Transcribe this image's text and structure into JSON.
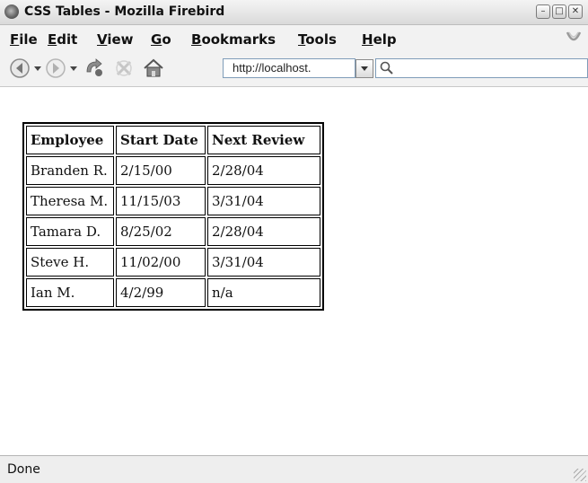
{
  "window": {
    "title": "CSS Tables - Mozilla Firebird",
    "controls": [
      "minimize",
      "maximize",
      "close"
    ]
  },
  "menu": {
    "items": [
      {
        "first": "F",
        "rest": "ile"
      },
      {
        "first": "E",
        "rest": "dit"
      },
      {
        "first": "V",
        "rest": "iew"
      },
      {
        "first": "G",
        "rest": "o"
      },
      {
        "first": "B",
        "rest": "ookmarks"
      },
      {
        "first": "T",
        "rest": "ools"
      },
      {
        "first": "H",
        "rest": "elp"
      }
    ]
  },
  "toolbar": {
    "icons": [
      "back-icon",
      "forward-icon",
      "reload-icon",
      "stop-icon",
      "home-icon"
    ],
    "url": "http://localhost.",
    "search_icon": "magnifier-icon"
  },
  "table": {
    "headers": [
      "Employee",
      "Start Date",
      "Next Review"
    ],
    "rows": [
      [
        "Branden R.",
        "2/15/00",
        "2/28/04"
      ],
      [
        "Theresa M.",
        "11/15/03",
        "3/31/04"
      ],
      [
        "Tamara D.",
        "8/25/02",
        "2/28/04"
      ],
      [
        "Steve H.",
        "11/02/00",
        "3/31/04"
      ],
      [
        "Ian M.",
        "4/2/99",
        "n/a"
      ]
    ]
  },
  "status": {
    "text": "Done"
  }
}
